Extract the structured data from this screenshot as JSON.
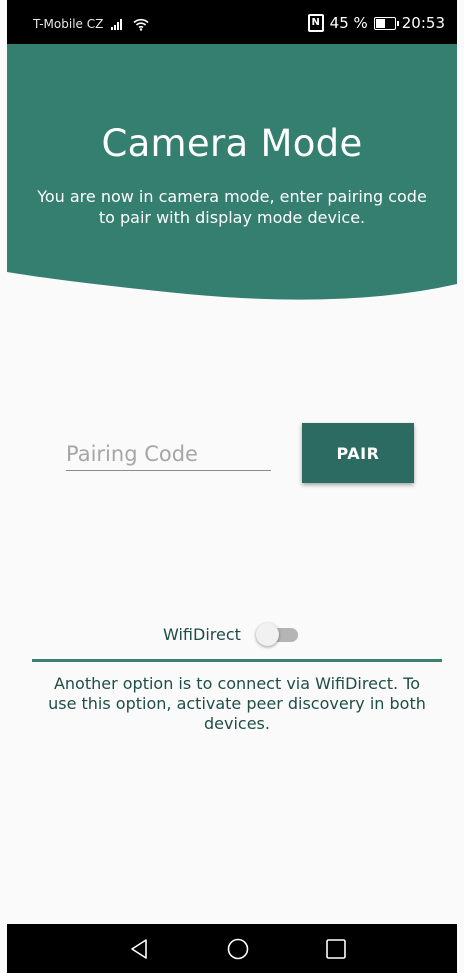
{
  "status_bar": {
    "carrier": "T-Mobile CZ",
    "battery_percent": "45 %",
    "time": "20:53",
    "nfc_label": "N",
    "icons": [
      "signal-icon",
      "wifi-icon",
      "nfc-icon",
      "battery-icon"
    ]
  },
  "header": {
    "title": "Camera Mode",
    "subtitle": "You are now in camera mode, enter pairing code to pair with display mode device.",
    "color": "#347f70"
  },
  "pairing": {
    "placeholder": "Pairing Code",
    "value": "",
    "button_label": "PAIR",
    "button_color": "#2b6b62"
  },
  "wifi_direct": {
    "label": "WifiDirect",
    "toggle_on": false,
    "note": "Another option is to connect via WifiDirect. To use this option, activate peer discovery in both devices."
  },
  "nav_bar": {
    "buttons": [
      "back-icon",
      "home-icon",
      "recents-icon"
    ]
  }
}
